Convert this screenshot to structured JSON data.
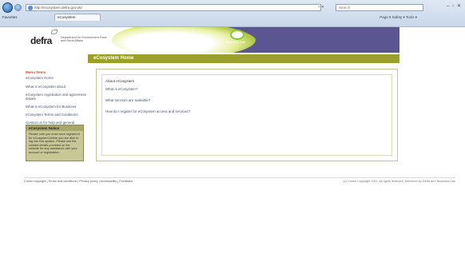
{
  "browser": {
    "address": "http://ecosystem.defra.gov.uk/",
    "address_tools": "+ ✕",
    "search_placeholder": "Search",
    "window_controls": "– ▫ ✕",
    "favorites_label": "Favorites",
    "tab_title": "eCosystem",
    "tab_tools": "Page ▾  Safety ▾  Tools ▾"
  },
  "header": {
    "logo": "defra",
    "org_name": "Department for Environment Food and Rural Affairs",
    "partner_text": "Business Link"
  },
  "page": {
    "title": "eCosystem Home"
  },
  "sidebar": {
    "section_title": "Menu Items",
    "items": [
      {
        "label": "eCosystem Home"
      },
      {
        "label": "What is eCosystem about"
      },
      {
        "label": "eCosystem registration and agreement details"
      },
      {
        "label": "What is eCosystem for Business"
      },
      {
        "label": "eCosystem Terms and Conditions"
      },
      {
        "label": "Contact us for help and general enquiries"
      }
    ]
  },
  "info_box": {
    "title": "eCosystem Notice",
    "body": "Please note you must have registered for eCosystem before you are able to log into this system. Please use the contact details provided on the website for any assistance with your account or registration."
  },
  "content": {
    "heading": "About eCosystem",
    "links": [
      {
        "label": "What is eCosystem?"
      },
      {
        "label": "What services are available?"
      },
      {
        "label": "How do I register for eCosystem access and services?"
      }
    ]
  },
  "footer": {
    "links": "Crown copyright | Terms and conditions | Privacy policy | Accessibility | Feedback",
    "copyright": "(c) Crown Copyright 2011, all rights reserved. Delivered by Defra and Business Link"
  }
}
